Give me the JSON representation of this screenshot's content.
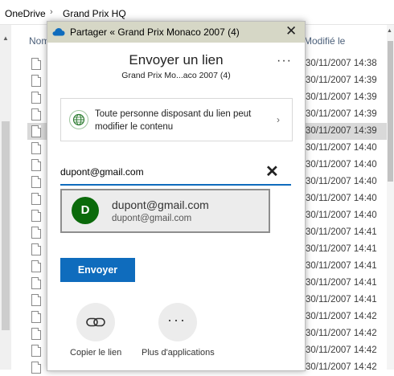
{
  "breadcrumb": {
    "root": "OneDrive",
    "folder": "Grand Prix HQ",
    "separator": "›"
  },
  "columns": {
    "name": "Nom",
    "modified": "Modifié le"
  },
  "files": [
    {
      "date": "30/11/2007 14:38"
    },
    {
      "date": "30/11/2007 14:39"
    },
    {
      "date": "30/11/2007 14:39"
    },
    {
      "date": "30/11/2007 14:39"
    },
    {
      "date": "30/11/2007 14:39"
    },
    {
      "date": "30/11/2007 14:40"
    },
    {
      "date": "30/11/2007 14:40"
    },
    {
      "date": "30/11/2007 14:40"
    },
    {
      "date": "30/11/2007 14:40"
    },
    {
      "date": "30/11/2007 14:40"
    },
    {
      "date": "30/11/2007 14:41"
    },
    {
      "date": "30/11/2007 14:41"
    },
    {
      "date": "30/11/2007 14:41"
    },
    {
      "date": "30/11/2007 14:41"
    },
    {
      "date": "30/11/2007 14:41"
    },
    {
      "date": "30/11/2007 14:42"
    },
    {
      "date": "30/11/2007 14:42"
    },
    {
      "date": "30/11/2007 14:42"
    },
    {
      "date": "30/11/2007 14:42"
    }
  ],
  "dialog": {
    "title": "Partager « Grand Prix Monaco 2007 (4)",
    "close_icon": "close-icon",
    "heading": "Envoyer un lien",
    "subheading": "Grand Prix Mo...aco 2007 (4)",
    "more_label": "···",
    "permission_text": "Toute personne disposant du lien peut modifier le contenu",
    "email_value": "dupont@gmail.com",
    "clear_label": "✕",
    "suggestion": {
      "initial": "D",
      "name": "dupont@gmail.com",
      "email": "dupont@gmail.com",
      "avatar_color": "#0b6a0b"
    },
    "send_label": "Envoyer",
    "copy_link_label": "Copier le lien",
    "more_apps_label": "Plus d'applications"
  },
  "colors": {
    "accent": "#0f6cbd",
    "titlebar": "#d6d7c6",
    "selected_row": "#d9d9d9"
  }
}
